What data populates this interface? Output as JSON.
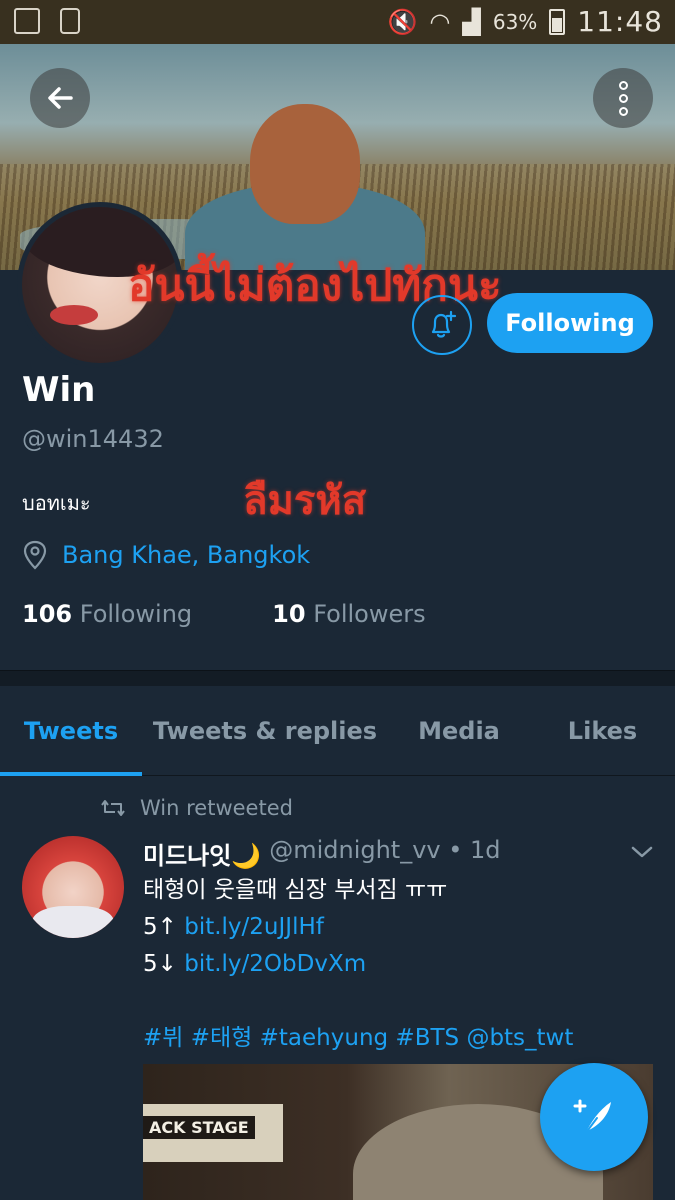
{
  "status_bar": {
    "battery": "63%",
    "time": "11:48"
  },
  "banner": {
    "back_icon": "arrow-left-icon",
    "menu_icon": "more-vertical-icon"
  },
  "overlay": {
    "line1": "อันนี้ไม่ต้องไปทักนะ",
    "line2": "ลืมรหัส"
  },
  "profile": {
    "name": "Win",
    "handle": "@win14432",
    "bio": "บอทเมะ",
    "location": "Bang Khae, Bangkok",
    "following_count": "106",
    "following_label": "Following",
    "followers_count": "10",
    "followers_label": "Followers",
    "follow_button": "Following"
  },
  "tabs": [
    {
      "label": "Tweets",
      "active": true
    },
    {
      "label": "Tweets & replies",
      "active": false
    },
    {
      "label": "Media",
      "active": false
    },
    {
      "label": "Likes",
      "active": false
    }
  ],
  "tweet": {
    "retweet_label": "Win retweeted",
    "display_name": "미드나잇🌙",
    "handle_time": "@midnight_vv • 1d",
    "line1": "태형이 웃을때 심장 부서짐 ㅠㅠ",
    "line2_prefix": "5↑ ",
    "line2_link": "bit.ly/2uJJlHf",
    "line3_prefix": "5↓ ",
    "line3_link": "bit.ly/2ObDvXm",
    "hashtags": "#뷔 #태형 #taehyung #BTS @bts_twt",
    "media_text": "ACK STAGE"
  },
  "colors": {
    "accent": "#1da1f2",
    "background": "#1b2836",
    "muted": "#8899a6",
    "overlay_red": "#e2392a"
  }
}
